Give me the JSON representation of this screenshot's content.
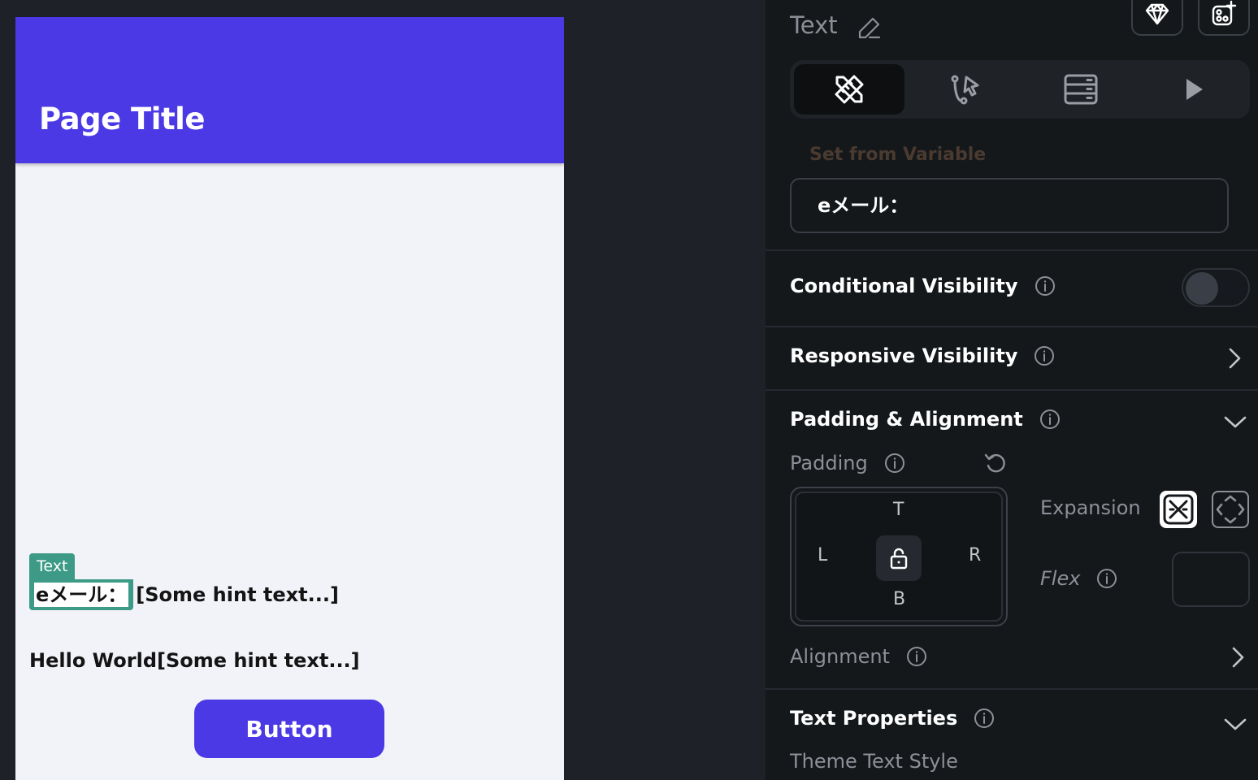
{
  "canvas": {
    "page_title": "Page Title",
    "selection_tag": "Text",
    "selected_text": "eメール：",
    "hint_text": "[Some hint text...]",
    "second_line": "Hello World[Some hint text...]",
    "button_label": "Button"
  },
  "panel": {
    "title": "Text",
    "tabs": [
      "properties",
      "actions",
      "backend-query",
      "preview"
    ],
    "active_tab": "properties",
    "set_from_variable_label": "Set from Variable",
    "text_value": "eメール：",
    "conditional_visibility": {
      "label": "Conditional Visibility",
      "enabled": false
    },
    "responsive_visibility": {
      "label": "Responsive Visibility"
    },
    "padding_alignment": {
      "label": "Padding & Alignment",
      "padding_label": "Padding",
      "sides": {
        "top": "T",
        "left": "L",
        "right": "R",
        "bottom": "B"
      },
      "expansion_label": "Expansion",
      "flex_label": "Flex",
      "alignment_label": "Alignment"
    },
    "text_properties": {
      "label": "Text Properties",
      "theme_text_style_label": "Theme Text Style"
    }
  },
  "colors": {
    "brand": "#4b39e6",
    "selection": "#3c9a86",
    "panel_bg": "#14181b",
    "app_bg": "#1e2128"
  }
}
